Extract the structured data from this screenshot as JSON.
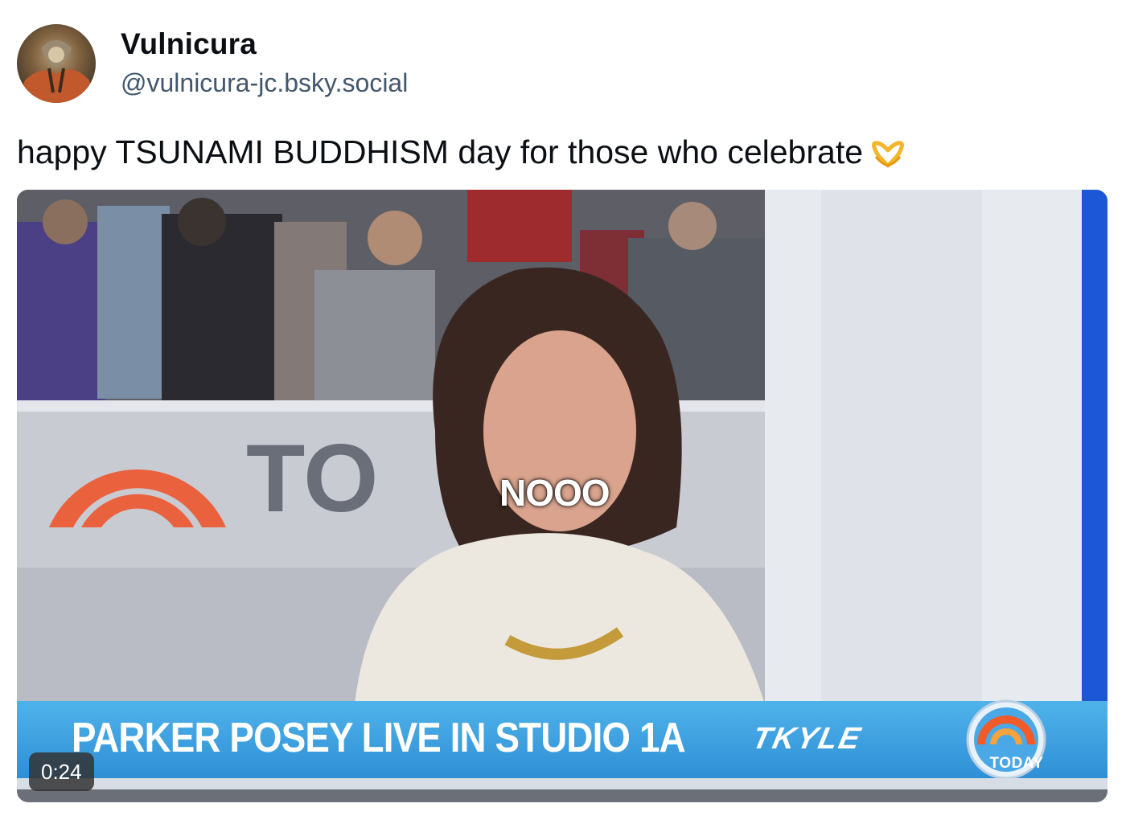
{
  "author": {
    "display_name": "Vulnicura",
    "handle": "@vulnicura-jc.bsky.social",
    "avatar_icon": "avatar-image"
  },
  "post": {
    "text": "happy TSUNAMI BUDDHISM day for those who celebrate",
    "emoji_icon": "heart-hands-icon"
  },
  "video": {
    "caption": "NOOO",
    "background_sign": "TO",
    "headline": "PARKER POSEY LIVE IN STUDIO 1A",
    "show_tag": "TKYLE",
    "network_logo": "TODAY",
    "duration": "0:24"
  },
  "colors": {
    "name": "#0b0f14",
    "handle": "#42576c",
    "band": "#2f8fd6",
    "logo_orange": "#f15a29"
  }
}
